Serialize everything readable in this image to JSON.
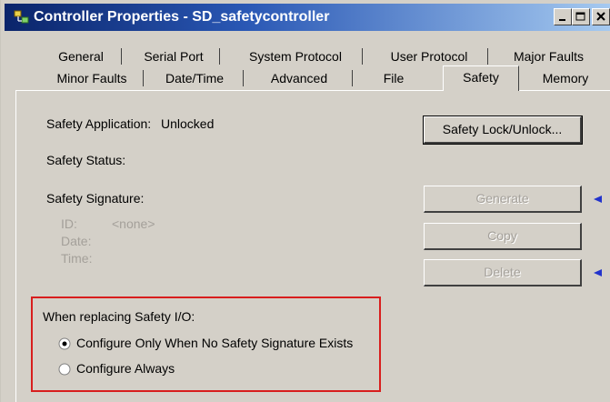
{
  "window": {
    "title": "Controller Properties - SD_safetycontroller",
    "controls": {
      "minimize": "_",
      "maximize": "□",
      "close": "X"
    }
  },
  "tabs": {
    "row1": [
      "General",
      "Serial Port",
      "System Protocol",
      "User Protocol",
      "Major Faults"
    ],
    "row2": [
      "Minor Faults",
      "Date/Time",
      "Advanced",
      "File",
      "Safety",
      "Memory"
    ],
    "active": "Safety"
  },
  "safety": {
    "application_label": "Safety Application:",
    "application_value": "Unlocked",
    "lock_button": "Safety Lock/Unlock...",
    "status_label": "Safety Status:",
    "signature_label": "Safety Signature:",
    "id_label": "ID:",
    "id_value": "<none>",
    "date_label": "Date:",
    "time_label": "Time:",
    "generate_button": "Generate",
    "copy_button": "Copy",
    "delete_button": "Delete"
  },
  "replace": {
    "heading": "When replacing Safety I/O:",
    "options": [
      "Configure Only When No Safety Signature Exists",
      "Configure Always"
    ],
    "selected": "Configure Only When No Safety Signature Exists"
  },
  "colors": {
    "highlight": "#d81e1e",
    "arrow": "#2233cc",
    "title_bar": "#0a246a"
  }
}
